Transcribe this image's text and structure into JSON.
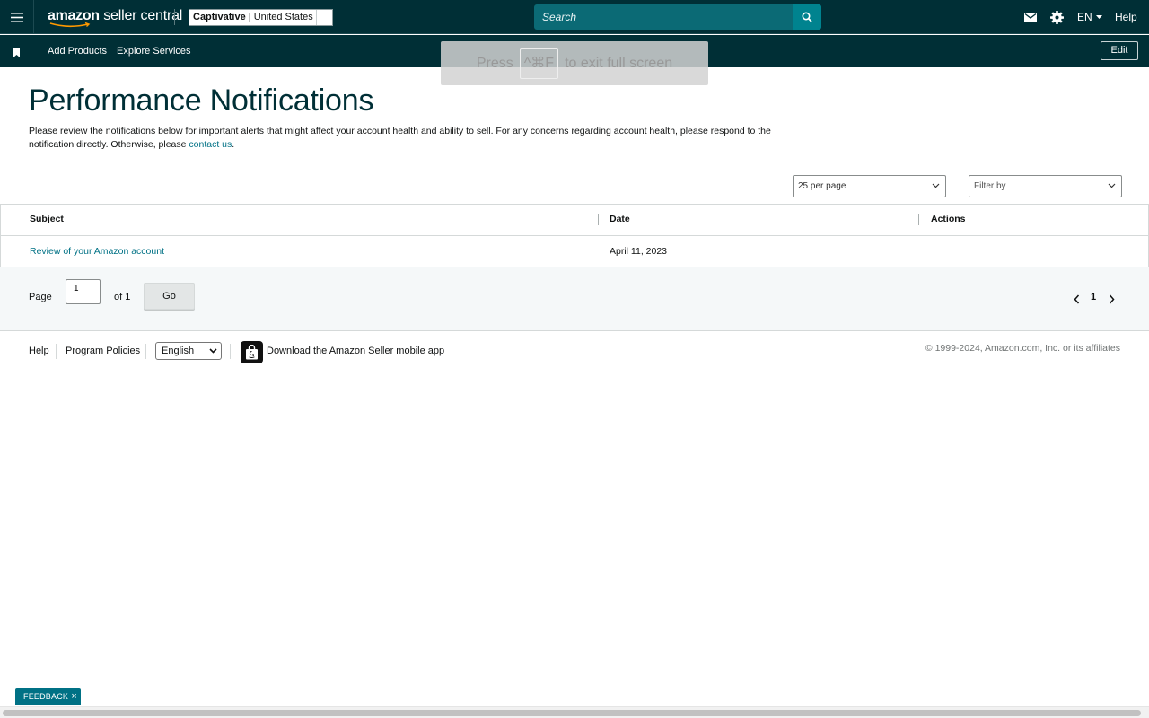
{
  "header": {
    "logo": {
      "brand": "amazon",
      "product": "seller central"
    },
    "account": {
      "store": "Captivative",
      "marketplace": "United States"
    },
    "search": {
      "placeholder": "Search"
    },
    "language": "EN",
    "help": "Help"
  },
  "subnav": {
    "items": [
      {
        "label": "Add Products"
      },
      {
        "label": "Explore Services"
      }
    ],
    "edit_label": "Edit"
  },
  "fullscreen_hint": {
    "before": "Press",
    "key": "^⌘F",
    "after": "to exit full screen"
  },
  "main": {
    "title": "Performance Notifications",
    "intro_text": "Please review the notifications below for important alerts that might affect your account health and ability to sell. For any concerns regarding account health, please respond to the notification directly. Otherwise, please",
    "intro_link": "contact us",
    "intro_end": ".",
    "per_page": "25 per page",
    "filter_placeholder": "Filter by",
    "table": {
      "columns": [
        "Subject",
        "Date",
        "Actions"
      ],
      "rows": [
        {
          "subject": "Review of your Amazon account",
          "date": "April 11, 2023",
          "actions": ""
        }
      ]
    },
    "pagination": {
      "page_label": "Page",
      "current_page": "1",
      "of_label": "of 1",
      "go_label": "Go",
      "page_number": "1"
    }
  },
  "footer": {
    "help": "Help",
    "program_policies": "Program Policies",
    "language": "English",
    "app_link": "Download the Amazon Seller mobile app",
    "copyright": "© 1999-2024, Amazon.com, Inc. or its affiliates"
  },
  "feedback": {
    "label": "FEEDBACK"
  },
  "colors": {
    "nav_bg": "#002f36",
    "search_bg": "#0b6a75",
    "search_button": "#00838f",
    "link": "#007185",
    "title": "#002f36"
  },
  "icons": {
    "menu": "hamburger-icon",
    "search": "search-icon",
    "mail": "mail-icon",
    "settings": "gear-icon",
    "bookmark": "bookmark-icon",
    "prev": "chevron-left-icon",
    "next": "chevron-right-icon",
    "close": "close-icon"
  }
}
